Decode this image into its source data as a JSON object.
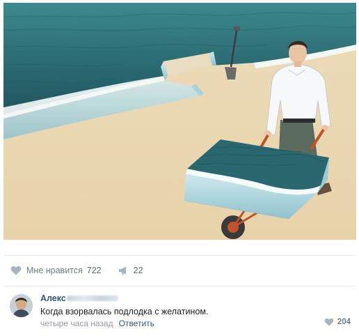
{
  "post": {
    "image_alt": "Man with a wheelbarrow carrying a block of the sea cut out from the beach",
    "actions": {
      "like_label": "Мне нравится",
      "like_count": "722",
      "share_count": "22",
      "like_icon": "heart-icon",
      "share_icon": "megaphone-icon"
    }
  },
  "comment": {
    "author_visible": "Алекс",
    "author_redacted": true,
    "text": "Когда взорвалась подлодка с желатином.",
    "time": "четыре часа назад",
    "reply_label": "Ответить",
    "like_count": "204",
    "like_icon": "heart-icon"
  },
  "colors": {
    "link": "#2a5885",
    "muted": "#939aa3",
    "action": "#6f7c8c",
    "divider": "#e7e8ec",
    "sand": "#ecdcb8",
    "sea": "#2d6b72"
  }
}
